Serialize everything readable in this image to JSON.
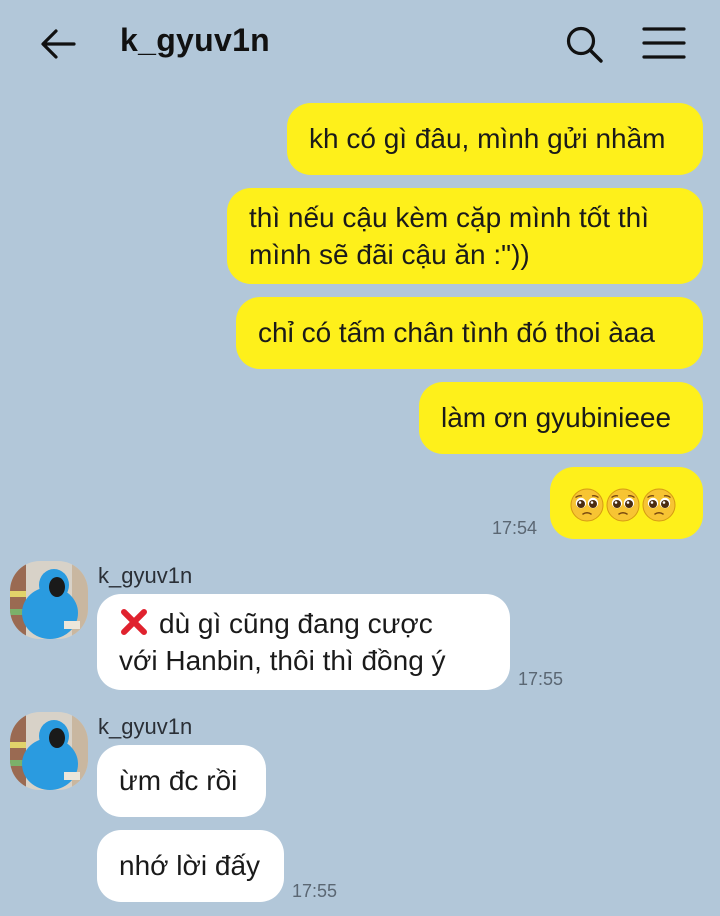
{
  "header": {
    "title": "k_gyuv1n"
  },
  "messages": {
    "me1": "kh có gì đâu, mình gửi nhầm",
    "me2_line1": "thì nếu cậu kèm cặp mình tốt thì",
    "me2_line2": "mình sẽ đãi cậu ăn :\"))",
    "me3": "chỉ có tấm chân tình đó thoi àaa",
    "me4": "làm ơn gyubinieee",
    "me5_icon": "pleading-face-emoji x3",
    "me5_time": "17:54",
    "other1_sender": "k_gyuv1n",
    "other1_icon": "red-x-icon",
    "other1_line1": "dù gì cũng đang cược",
    "other1_line2": "với Hanbin, thôi thì đồng ý",
    "other1_time": "17:55",
    "other2_sender": "k_gyuv1n",
    "other2_msg1": "ừm đc rồi",
    "other2_msg2": "nhớ lời đấy",
    "other2_time": "17:55"
  },
  "colors": {
    "background": "#b2c7d9",
    "my_bubble": "#fef01b",
    "other_bubble": "#ffffff",
    "avatar_hoodie": "#2a9be0"
  }
}
